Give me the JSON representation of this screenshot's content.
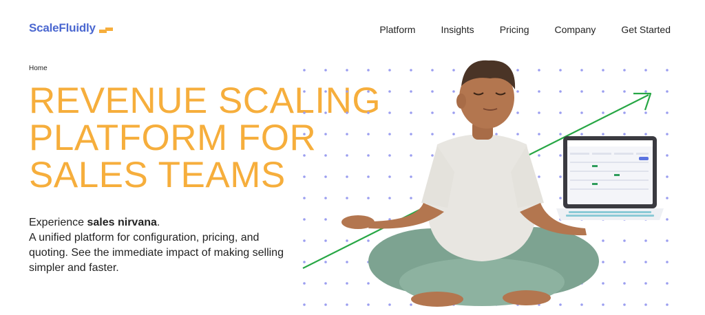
{
  "brand": {
    "name": "ScaleFluidly",
    "color": "#4a67d0",
    "accent": "#f6ae3c"
  },
  "nav": {
    "items": [
      {
        "label": "Platform"
      },
      {
        "label": "Insights"
      },
      {
        "label": "Pricing"
      },
      {
        "label": "Company"
      },
      {
        "label": "Get Started"
      }
    ]
  },
  "breadcrumb": {
    "home": "Home"
  },
  "hero": {
    "headline": [
      "REVENUE SCALING",
      "PLATFORM FOR",
      "SALES TEAMS"
    ],
    "lead_prefix": "Experience ",
    "lead_bold": "sales nirvana",
    "lead_suffix": ".",
    "lead_body": "A unified platform for configuration, pricing, and quoting. See the immediate impact of making selling simpler and faster."
  },
  "illustration": {
    "subject": "meditating-person-with-laptop-icon",
    "arrow_color": "#27a745",
    "dot_color": "#9b9ef0"
  }
}
